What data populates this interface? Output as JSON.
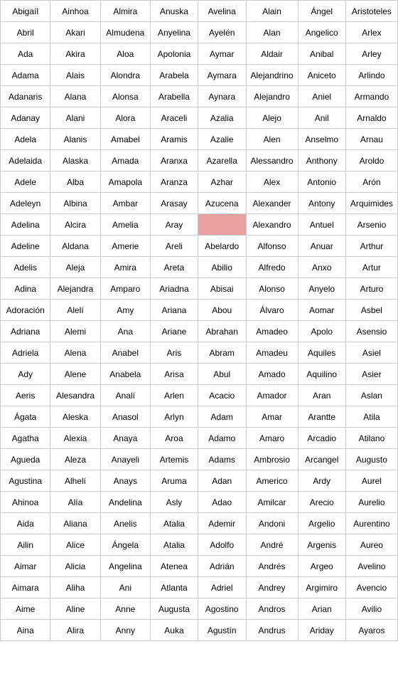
{
  "rows": [
    [
      "Abigaíl",
      "Ainhoa",
      "Almira",
      "Anuska",
      "Avelina",
      "Alain",
      "Ángel",
      "Aristoteles"
    ],
    [
      "Abril",
      "Akari",
      "Almudena",
      "Anyelina",
      "Ayelén",
      "Alan",
      "Angelico",
      "Arlex"
    ],
    [
      "Ada",
      "Akira",
      "Aloa",
      "Apolonia",
      "Aymar",
      "Aldair",
      "Anibal",
      "Arley"
    ],
    [
      "Adama",
      "Alais",
      "Alondra",
      "Arabela",
      "Aymara",
      "Alejandrino",
      "Aniceto",
      "Arlindo"
    ],
    [
      "Adanaris",
      "Alana",
      "Alonsa",
      "Arabella",
      "Aynara",
      "Alejandro",
      "Aniel",
      "Armando"
    ],
    [
      "Adanay",
      "Alani",
      "Alora",
      "Araceli",
      "Azalia",
      "Alejo",
      "Anil",
      "Arnaldo"
    ],
    [
      "Adela",
      "Alanis",
      "Amabel",
      "Aramis",
      "Azalie",
      "Alen",
      "Anselmo",
      "Arnau"
    ],
    [
      "Adelaida",
      "Alaska",
      "Amada",
      "Aranxa",
      "Azarella",
      "Alessandro",
      "Anthony",
      "Aroldo"
    ],
    [
      "Adele",
      "Alba",
      "Amapola",
      "Aranza",
      "Azhar",
      "Alex",
      "Antonio",
      "Arón"
    ],
    [
      "Adeleyn",
      "Albina",
      "Ambar",
      "Arasay",
      "Azucena",
      "Alexander",
      "Antony",
      "Arquimides"
    ],
    [
      "Adelina",
      "Alcira",
      "Amelia",
      "Aray",
      "",
      "Alexandro",
      "Antuel",
      "Arsenio"
    ],
    [
      "Adeline",
      "Aldana",
      "Amerie",
      "Areli",
      "Abelardo",
      "Alfonso",
      "Anuar",
      "Arthur"
    ],
    [
      "Adelis",
      "Aleja",
      "Amira",
      "Areta",
      "Abilio",
      "Alfredo",
      "Anxo",
      "Artur"
    ],
    [
      "Adina",
      "Alejandra",
      "Amparo",
      "Ariadna",
      "Abisai",
      "Alonso",
      "Anyelo",
      "Arturo"
    ],
    [
      "Adoración",
      "Alelí",
      "Amy",
      "Ariana",
      "Abou",
      "Álvaro",
      "Aomar",
      "Asbel"
    ],
    [
      "Adriana",
      "Alemi",
      "Ana",
      "Ariane",
      "Abrahan",
      "Amadeo",
      "Apolo",
      "Asensio"
    ],
    [
      "Adriela",
      "Alena",
      "Anabel",
      "Aris",
      "Abram",
      "Amadeu",
      "Aquiles",
      "Asiel"
    ],
    [
      "Ady",
      "Alene",
      "Anabela",
      "Arisa",
      "Abul",
      "Amado",
      "Aquilino",
      "Asier"
    ],
    [
      "Aeris",
      "Alesandra",
      "Analí",
      "Arlen",
      "Acacio",
      "Amador",
      "Aran",
      "Aslan"
    ],
    [
      "Ágata",
      "Aleska",
      "Anasol",
      "Arlyn",
      "Adam",
      "Amar",
      "Arantte",
      "Atila"
    ],
    [
      "Agatha",
      "Alexia",
      "Anaya",
      "Aroa",
      "Adamo",
      "Amaro",
      "Arcadio",
      "Atilano"
    ],
    [
      "Agueda",
      "Aleza",
      "Anayeli",
      "Artemis",
      "Adams",
      "Ambrosio",
      "Arcangel",
      "Augusto"
    ],
    [
      "Agustina",
      "Alhelí",
      "Anays",
      "Aruma",
      "Adan",
      "Americo",
      "Ardy",
      "Aurel"
    ],
    [
      "Ahinoa",
      "Alía",
      "Andelina",
      "Asly",
      "Adao",
      "Amilcar",
      "Arecio",
      "Aurelio"
    ],
    [
      "Aida",
      "Aliana",
      "Anelis",
      "Atalia",
      "Ademir",
      "Andoni",
      "Argelio",
      "Aurentino"
    ],
    [
      "Ailin",
      "Alice",
      "Ángela",
      "Atalia",
      "Adolfo",
      "André",
      "Argenis",
      "Aureo"
    ],
    [
      "Aimar",
      "Alicia",
      "Angelina",
      "Atenea",
      "Adrián",
      "Andrés",
      "Argeo",
      "Avelino"
    ],
    [
      "Aimara",
      "Aliha",
      "Ani",
      "Atlanta",
      "Adriel",
      "Andrey",
      "Argimiro",
      "Avencio"
    ],
    [
      "Aime",
      "Aline",
      "Anne",
      "Augusta",
      "Agostino",
      "Andros",
      "Arian",
      "Avilio"
    ],
    [
      "Aina",
      "Alira",
      "Anny",
      "Auka",
      "Agustín",
      "Andrus",
      "Ariday",
      "Ayaros"
    ]
  ],
  "highlightedCell": {
    "row": 10,
    "col": 4
  },
  "anthonyCell": {
    "row": 7,
    "col": 6
  }
}
